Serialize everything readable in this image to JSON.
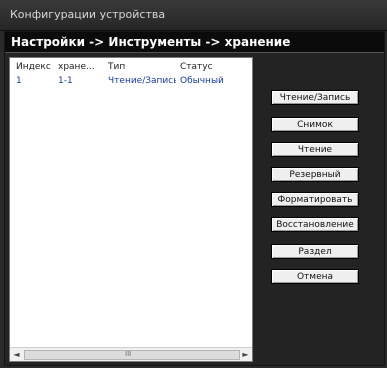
{
  "window": {
    "title": "Конфигурации устройства"
  },
  "breadcrumb": {
    "text": "Настройки -> Инструменты -> хранение"
  },
  "table": {
    "columns": [
      "Индекс",
      "хране...",
      "Тип",
      "Статус"
    ],
    "rows": [
      {
        "index": "1",
        "storage": "1-1",
        "type": "Чтение/Запись",
        "status": "Обычный"
      }
    ]
  },
  "scrollbar": {
    "left_arrow": "◄",
    "right_arrow": "►",
    "grip": "III"
  },
  "buttons": {
    "read_write": "Чтение/Запись",
    "snapshot": "Снимок",
    "read": "Чтение",
    "reserve": "Резервный",
    "format": "Форматировать",
    "restore": "Восстановление",
    "partition": "Раздел",
    "cancel": "Отмена"
  }
}
